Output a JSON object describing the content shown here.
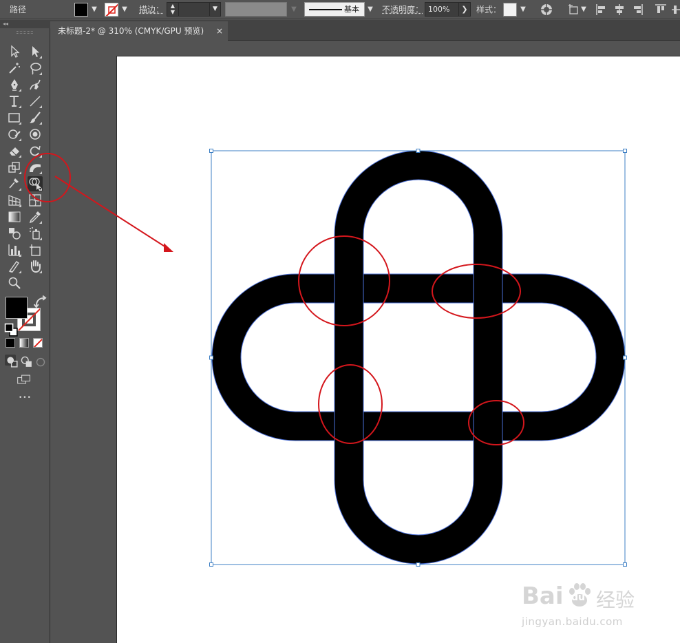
{
  "control_bar": {
    "selection_type": "路径",
    "fill_color": "#000000",
    "stroke_label": "描边：",
    "stroke_weight": "",
    "profile_label": "基本",
    "opacity_label": "不透明度：",
    "opacity_value": "100%",
    "style_label": "样式："
  },
  "document": {
    "tab_title": "未标题-2* @ 310% (CMYK/GPU 预览)",
    "close_glyph": "×"
  },
  "toolbox": {
    "collapse_glyph": "◂◂",
    "more_glyph": "•••",
    "tools": [
      "selection-tool",
      "direct-selection-tool",
      "magic-wand-tool",
      "lasso-tool",
      "pen-tool",
      "curvature-tool",
      "type-tool",
      "line-segment-tool",
      "rectangle-tool",
      "paintbrush-tool",
      "shaper-tool",
      "blob-brush-tool",
      "eraser-tool",
      "rotate-tool",
      "scale-tool",
      "width-tool",
      "puppet-warp-tool",
      "shape-builder-tool",
      "perspective-grid-tool",
      "mesh-tool",
      "gradient-tool",
      "eyedropper-tool",
      "blend-tool",
      "symbol-sprayer-tool",
      "column-graph-tool",
      "artboard-tool",
      "slice-tool",
      "hand-tool",
      "zoom-tool"
    ],
    "selected_tool": "shape-builder-tool"
  },
  "colors": {
    "annotation_red": "#d4161c",
    "path_blue": "#4a6fd8",
    "bounding_box": "#3d7fc4",
    "fill": "#000000"
  },
  "watermark": {
    "brand_a": "Bai",
    "brand_b": "du",
    "brand_c": "经验",
    "url": "jingyan.baidu.com"
  }
}
